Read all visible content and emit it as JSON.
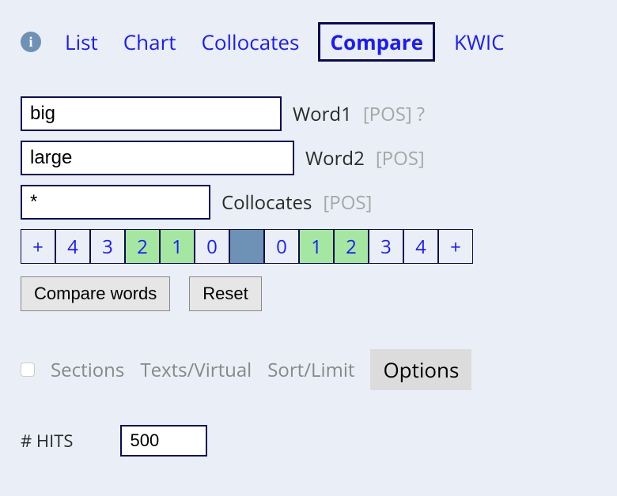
{
  "tabs": {
    "info_glyph": "i",
    "items": [
      "List",
      "Chart",
      "Collocates",
      "Compare",
      "KWIC"
    ],
    "active_index": 3
  },
  "word1": {
    "value": "big",
    "label": "Word1",
    "pos": "[POS]",
    "help": "?"
  },
  "word2": {
    "value": "large",
    "label": "Word2",
    "pos": "[POS]"
  },
  "collocates": {
    "value": "*",
    "label": "Collocates",
    "pos": "[POS]"
  },
  "span": {
    "left": [
      {
        "v": "+",
        "g": false
      },
      {
        "v": "4",
        "g": false
      },
      {
        "v": "3",
        "g": false
      },
      {
        "v": "2",
        "g": true
      },
      {
        "v": "1",
        "g": true
      },
      {
        "v": "0",
        "g": false
      }
    ],
    "right": [
      {
        "v": "0",
        "g": false
      },
      {
        "v": "1",
        "g": true
      },
      {
        "v": "2",
        "g": true
      },
      {
        "v": "3",
        "g": false
      },
      {
        "v": "4",
        "g": false
      },
      {
        "v": "+",
        "g": false
      }
    ]
  },
  "buttons": {
    "compare": "Compare words",
    "reset": "Reset"
  },
  "options": {
    "sections": "Sections",
    "texts": "Texts/Virtual",
    "sort": "Sort/Limit",
    "options": "Options"
  },
  "hits": {
    "label": "# HITS",
    "value": "500"
  }
}
